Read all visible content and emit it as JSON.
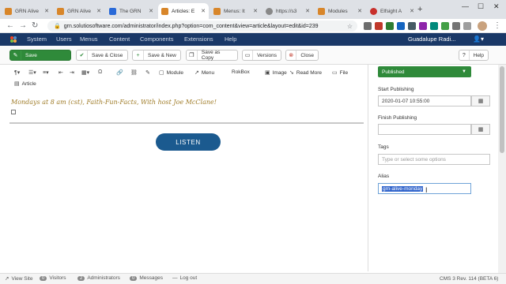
{
  "browser": {
    "tabs": [
      {
        "label": "GRN Alive",
        "fav_color": "#d8862a"
      },
      {
        "label": "GRN Alive",
        "fav_color": "#d8862a"
      },
      {
        "label": "The GRN",
        "fav_color": "#2a6ad8"
      },
      {
        "label": "Articles: E",
        "fav_color": "#d8862a",
        "active": true
      },
      {
        "label": "Menus: It",
        "fav_color": "#d8862a"
      },
      {
        "label": "https://s3",
        "fav_color": "#888888"
      },
      {
        "label": "Modules",
        "fav_color": "#d8862a"
      },
      {
        "label": "Elfsight A",
        "fav_color": "#c8302c"
      }
    ],
    "new_tab_label": "+",
    "url": "grn.solutiosoftware.com/administrator/index.php?option=com_content&view=article&layout=edit&id=239"
  },
  "admin": {
    "menu": [
      "System",
      "Users",
      "Menus",
      "Content",
      "Components",
      "Extensions",
      "Help"
    ],
    "site_name": "Guadalupe Radi...",
    "brand_color": "#1a3867"
  },
  "toolbar": {
    "save": "Save",
    "save_close": "Save & Close",
    "save_new": "Save & New",
    "save_copy": "Save as Copy",
    "versions": "Versions",
    "close": "Close",
    "help": "Help"
  },
  "editor_tools": {
    "module": "Module",
    "menu": "Menu",
    "rokbox": "RokBox",
    "image": "Image",
    "read_more": "Read More",
    "file": "File",
    "article": "Article"
  },
  "content": {
    "text": "Mondays at 8 am (cst), Faith-Fun-Facts, With host Joe McClane!",
    "listen_button": "LISTEN",
    "text_color": "#a07d2a",
    "button_color": "#1b5a8f"
  },
  "sidebar": {
    "status": "Published",
    "status_color": "#2f8a3a",
    "start_publishing_label": "Start Publishing",
    "start_publishing_value": "2020-01-07 10:55:00",
    "finish_publishing_label": "Finish Publishing",
    "finish_publishing_value": "",
    "tags_label": "Tags",
    "tags_placeholder": "Type or select some options",
    "alias_label": "Alias",
    "alias_value": "grn-alive-monday"
  },
  "footer": {
    "view_site": "View Site",
    "visitors_count": "0",
    "visitors": "Visitors",
    "admins_count": "2",
    "administrators": "Administrators",
    "messages_count": "0",
    "messages": "Messages",
    "logout": "Log out",
    "version": "CMS 3 Rev. 114 (BETA 6)"
  }
}
